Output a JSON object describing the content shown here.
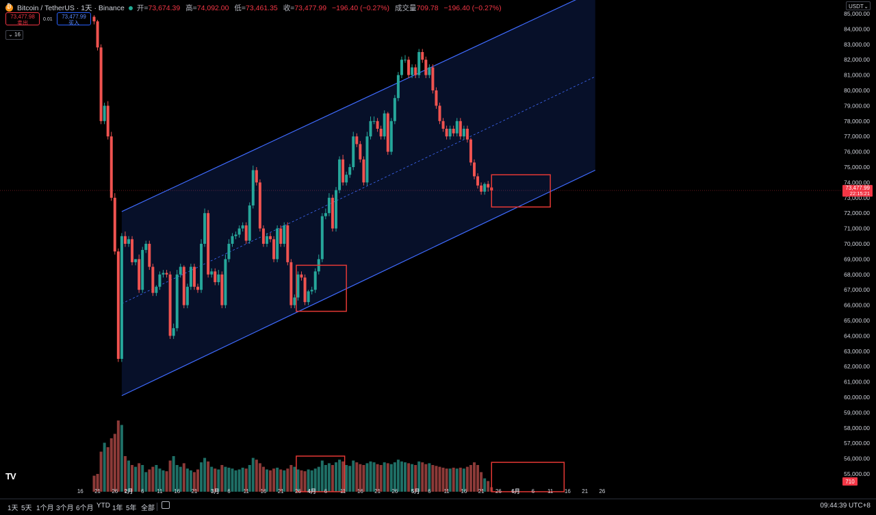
{
  "header": {
    "symbol": "Bitcoin / TetherUS",
    "interval": "1天",
    "exchange": "Binance",
    "open_label": "开=",
    "open": "73,674.39",
    "high_label": "高=",
    "high": "74,092.00",
    "low_label": "低=",
    "low": "73,461.35",
    "close_label": "收=",
    "close": "73,477.99",
    "change": "−196.40 (−0.27%)",
    "volume_label": "成交量",
    "volume": "709.78",
    "volume_change": "−196.40 (−0.27%)"
  },
  "trade": {
    "sell_price": "73,477.98",
    "sell_label": "卖出",
    "spread": "0.01",
    "buy_price": "73,477.99",
    "buy_label": "买入",
    "indicator_count": "16"
  },
  "currency": "USDT",
  "price_tag": {
    "price": "73,477.99",
    "time": "22:15:21"
  },
  "volume_tag": "710",
  "bottom_bar": {
    "timeframes": [
      "1天",
      "5天",
      "1个月",
      "3个月",
      "6个月",
      "YTD",
      "1年",
      "5年",
      "全部"
    ],
    "clock": "09:44:39 UTC+8"
  },
  "colors": {
    "up": "#26a69a",
    "down": "#ef5350",
    "channel": "#2962ff",
    "box": "#e53935",
    "background": "#000000"
  },
  "chart_data": {
    "type": "candlestick",
    "title": "Bitcoin / TetherUS · 1天 · Binance",
    "ylim": [
      54400,
      85400
    ],
    "y_ticks": [
      55000,
      56000,
      57000,
      58000,
      59000,
      60000,
      61000,
      62000,
      63000,
      64000,
      65000,
      66000,
      67000,
      68000,
      69000,
      70000,
      71000,
      72000,
      73000,
      74000,
      75000,
      76000,
      77000,
      78000,
      79000,
      80000,
      81000,
      82000,
      83000,
      84000,
      85000
    ],
    "y_tick_labels": [
      "55,000.00",
      "56,000.00",
      "57,000.00",
      "58,000.00",
      "59,000.00",
      "60,000.00",
      "61,000.00",
      "62,000.00",
      "63,000.00",
      "64,000.00",
      "65,000.00",
      "66,000.00",
      "67,000.00",
      "68,000.00",
      "69,000.00",
      "70,000.00",
      "71,000.00",
      "72,000.00",
      "73,000.00",
      "74,000.00",
      "75,000.00",
      "76,000.00",
      "77,000.00",
      "78,000.00",
      "79,000.00",
      "80,000.00",
      "81,000.00",
      "82,000.00",
      "83,000.00",
      "84,000.00",
      "85,000.00"
    ],
    "x_tick_labels": [
      "16",
      "21",
      "26",
      "2月",
      "6",
      "11",
      "16",
      "21",
      "3月",
      "6",
      "11",
      "16",
      "21",
      "26",
      "4月",
      "6",
      "11",
      "16",
      "21",
      "26",
      "5月",
      "6",
      "11",
      "16",
      "21",
      "26",
      "6月",
      "6",
      "11",
      "16",
      "21",
      "26"
    ],
    "x_tick_bar_index": [
      -4,
      1,
      6,
      10,
      14,
      19,
      24,
      29,
      35,
      39,
      44,
      49,
      54,
      59,
      63,
      67,
      72,
      77,
      82,
      87,
      93,
      97,
      102,
      107,
      112,
      117,
      122,
      127,
      132,
      137,
      142,
      147
    ],
    "bars_open": [
      84800,
      84500,
      82800,
      78000,
      79000,
      77000,
      73000,
      69500,
      62500,
      70500,
      70000,
      70300,
      68800,
      69000,
      67000,
      69600,
      70000,
      68500,
      66800,
      67200,
      68000,
      68100,
      68000,
      64000,
      64500,
      68000,
      68500,
      66000,
      67200,
      68500,
      67200,
      67000,
      70000,
      72000,
      68000,
      68200,
      67500,
      68000,
      66000,
      69000,
      70000,
      70500,
      70600,
      71000,
      71200,
      70200,
      72500,
      74800,
      74000,
      71000,
      70000,
      70500,
      70300,
      69000,
      71000,
      70000,
      71200,
      68800,
      66000,
      66500,
      68000,
      67800,
      66200,
      66900,
      67000,
      68200,
      69000,
      71800,
      72000,
      73000,
      71000,
      73500,
      75500,
      74000,
      74500,
      75000,
      77000,
      76500,
      75500,
      74000,
      77000,
      78000,
      78000,
      77500,
      77000,
      78500,
      76000,
      78000,
      79500,
      81000,
      82000,
      82000,
      81000,
      81500,
      81000,
      82500,
      82000,
      81000,
      81500,
      80000,
      79000,
      78000,
      77500,
      77000,
      77500,
      77200,
      78000,
      77000,
      77500,
      76800,
      75300,
      74400,
      73800,
      73400,
      73900,
      73674
    ],
    "bars_close": [
      84500,
      82800,
      78000,
      79000,
      77000,
      73000,
      69500,
      62500,
      70500,
      70000,
      70300,
      68800,
      69000,
      67000,
      69600,
      70000,
      68500,
      66800,
      67200,
      68000,
      68100,
      68000,
      64000,
      64500,
      68000,
      68500,
      66000,
      67200,
      68500,
      67200,
      67000,
      70000,
      72000,
      68000,
      68200,
      67500,
      68000,
      66000,
      69000,
      70000,
      70500,
      70600,
      71000,
      71200,
      70200,
      72500,
      74800,
      74000,
      71000,
      70000,
      70500,
      70300,
      69000,
      71000,
      70000,
      71200,
      68800,
      66000,
      66500,
      68000,
      67800,
      66200,
      66900,
      67000,
      68200,
      69000,
      71800,
      72000,
      73000,
      71000,
      73500,
      75500,
      74000,
      74500,
      75000,
      77000,
      76500,
      75500,
      74000,
      77000,
      78000,
      78000,
      77500,
      77000,
      78500,
      76000,
      78000,
      79500,
      81000,
      82000,
      82000,
      81000,
      81500,
      81000,
      82500,
      82000,
      81000,
      81500,
      80000,
      79000,
      78000,
      77500,
      77000,
      77500,
      77200,
      78000,
      77000,
      77500,
      76800,
      75300,
      74400,
      73800,
      73400,
      73900,
      73674,
      73478
    ],
    "bars_high": [
      84900,
      84600,
      83000,
      79200,
      79300,
      77300,
      73300,
      69700,
      70700,
      70800,
      70500,
      70500,
      69000,
      69300,
      69800,
      70200,
      70200,
      68700,
      67300,
      68200,
      68300,
      68300,
      68200,
      64800,
      68300,
      68700,
      68600,
      67400,
      68700,
      68700,
      67400,
      70300,
      72300,
      72200,
      68400,
      68400,
      68300,
      68200,
      69300,
      70300,
      70700,
      70800,
      71200,
      71400,
      71400,
      72700,
      75100,
      75000,
      74200,
      71200,
      70700,
      70700,
      70500,
      71200,
      71200,
      71400,
      71400,
      69000,
      66700,
      68200,
      68200,
      68000,
      67000,
      67200,
      68400,
      69300,
      72000,
      72300,
      73300,
      73200,
      73700,
      75700,
      75800,
      74700,
      75200,
      77300,
      77200,
      76700,
      75700,
      77300,
      78300,
      78300,
      78200,
      77700,
      78700,
      78600,
      78200,
      79700,
      81200,
      82200,
      82300,
      82200,
      81700,
      81700,
      82700,
      82700,
      82200,
      81700,
      81700,
      80200,
      79200,
      78200,
      77700,
      77700,
      77700,
      78200,
      78200,
      77700,
      77700,
      76900,
      75500,
      74600,
      74000,
      74000,
      74100,
      73900
    ],
    "bars_low": [
      84300,
      82600,
      77800,
      77800,
      76800,
      72800,
      69300,
      62300,
      62300,
      69800,
      69800,
      68600,
      68600,
      66800,
      66800,
      69400,
      68300,
      66600,
      66600,
      67000,
      67800,
      67800,
      63800,
      63800,
      64300,
      67800,
      65800,
      65800,
      67000,
      67000,
      66800,
      66800,
      69800,
      67800,
      67800,
      67300,
      67300,
      65800,
      65800,
      68800,
      69800,
      70300,
      70400,
      70800,
      70000,
      70000,
      72300,
      73800,
      70800,
      69800,
      69800,
      70100,
      68800,
      68800,
      69800,
      69800,
      68600,
      65800,
      65800,
      66300,
      67600,
      66000,
      66000,
      66700,
      66800,
      68000,
      68800,
      71600,
      71800,
      70800,
      70800,
      73300,
      73800,
      73800,
      74300,
      74800,
      76300,
      75300,
      73800,
      73800,
      76800,
      77800,
      77300,
      76800,
      76800,
      75800,
      75800,
      77800,
      79300,
      80800,
      81800,
      80800,
      80800,
      80800,
      80800,
      81800,
      80800,
      80800,
      79800,
      78800,
      77800,
      77300,
      76800,
      76800,
      77000,
      77000,
      76800,
      76800,
      76600,
      75100,
      74200,
      73600,
      73200,
      73200,
      73400,
      73400
    ],
    "volume_relative": [
      0.18,
      0.2,
      0.45,
      0.55,
      0.5,
      0.6,
      0.65,
      0.8,
      0.75,
      0.4,
      0.35,
      0.3,
      0.28,
      0.32,
      0.3,
      0.22,
      0.25,
      0.28,
      0.3,
      0.26,
      0.24,
      0.23,
      0.35,
      0.4,
      0.3,
      0.28,
      0.32,
      0.26,
      0.24,
      0.22,
      0.25,
      0.33,
      0.38,
      0.34,
      0.28,
      0.26,
      0.25,
      0.3,
      0.28,
      0.27,
      0.26,
      0.24,
      0.25,
      0.27,
      0.26,
      0.3,
      0.38,
      0.36,
      0.32,
      0.28,
      0.25,
      0.24,
      0.26,
      0.27,
      0.25,
      0.24,
      0.26,
      0.3,
      0.28,
      0.25,
      0.24,
      0.23,
      0.25,
      0.24,
      0.26,
      0.28,
      0.35,
      0.3,
      0.32,
      0.3,
      0.33,
      0.36,
      0.34,
      0.3,
      0.29,
      0.35,
      0.33,
      0.31,
      0.3,
      0.32,
      0.34,
      0.33,
      0.31,
      0.3,
      0.33,
      0.32,
      0.31,
      0.33,
      0.36,
      0.34,
      0.33,
      0.32,
      0.31,
      0.3,
      0.34,
      0.33,
      0.31,
      0.32,
      0.3,
      0.29,
      0.28,
      0.27,
      0.26,
      0.26,
      0.27,
      0.26,
      0.27,
      0.26,
      0.28,
      0.3,
      0.33,
      0.3,
      0.22,
      0.15,
      0.12,
      0.05
    ],
    "channel": {
      "upper": [
        {
          "bar": 8,
          "price": 72100
        },
        {
          "bar": 145,
          "price": 86500
        }
      ],
      "mid": [
        {
          "bar": 8,
          "price": 66100
        },
        {
          "bar": 145,
          "price": 80900
        }
      ],
      "lower": [
        {
          "bar": 8,
          "price": 60100
        },
        {
          "bar": 145,
          "price": 74800
        }
      ]
    },
    "annotation_boxes": [
      {
        "bar_from": 58.5,
        "bar_to": 73,
        "price_from": 65600,
        "price_to": 68600
      },
      {
        "bar_from": 115,
        "bar_to": 132,
        "price_from": 72400,
        "price_to": 74500
      }
    ],
    "volume_annotation_boxes": [
      {
        "bar_from": 58.5,
        "bar_to": 72.5,
        "vol_from": 0,
        "vol_to": 0.4
      },
      {
        "bar_from": 115,
        "bar_to": 136,
        "vol_from": 0,
        "vol_to": 0.33
      }
    ],
    "current_price": 73478
  }
}
